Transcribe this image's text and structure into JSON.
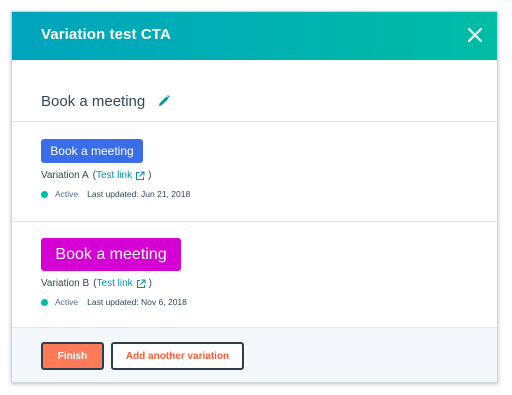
{
  "dialog": {
    "title": "Variation test CTA",
    "close_icon": "close-icon"
  },
  "section": {
    "title": "Book a meeting",
    "edit_icon": "pencil-icon"
  },
  "variations": [
    {
      "cta_label": "Book a meeting",
      "cta_color": "#3a6ee8",
      "name": "Variation A",
      "open_paren": "(",
      "test_link": "Test link",
      "close_paren": ")",
      "status": "Active",
      "status_color": "#00bda5",
      "last_updated": "Last updated: Jun 21, 2018"
    },
    {
      "cta_label": "Book a meeting",
      "cta_color": "#d400d4",
      "name": "Variation B",
      "open_paren": "(",
      "test_link": "Test link",
      "close_paren": ")",
      "status": "Active",
      "status_color": "#00bda5",
      "last_updated": "Last updated: Nov 6, 2018"
    }
  ],
  "footer": {
    "finish_label": "Finish",
    "add_label": "Add another variation"
  },
  "colors": {
    "header_gradient_start": "#00a4bd",
    "header_gradient_end": "#00bda5",
    "finish_button": "#ff7a59",
    "link": "#0091ae"
  }
}
